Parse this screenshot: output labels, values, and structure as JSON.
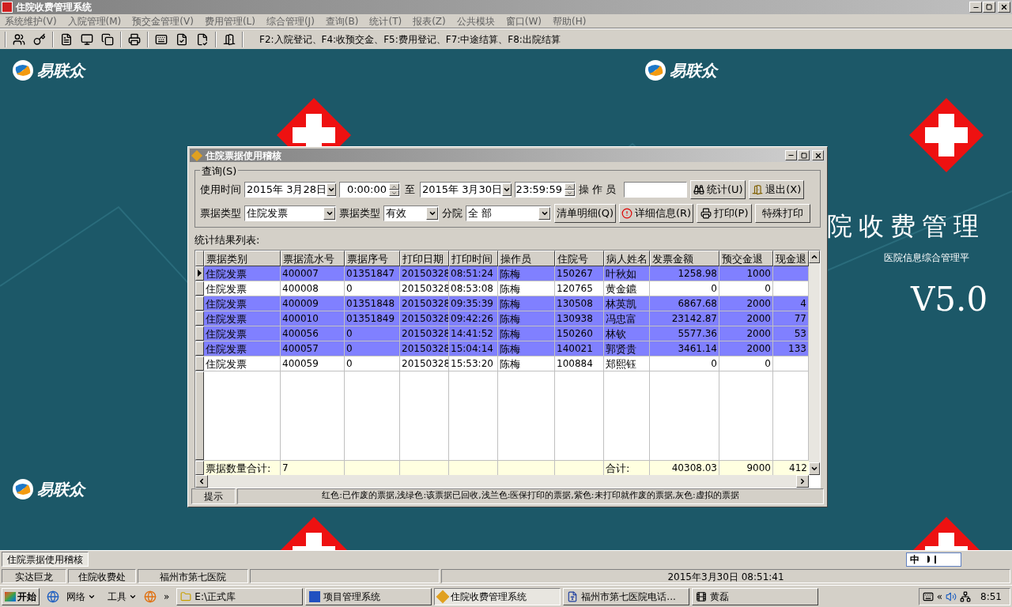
{
  "window": {
    "title": "住院收费管理系统"
  },
  "menu": [
    "系统维护(V)",
    "入院管理(M)",
    "预交金管理(V)",
    "费用管理(L)",
    "综合管理(J)",
    "查询(B)",
    "统计(T)",
    "报表(Z)",
    "公共模块",
    "窗口(W)",
    "帮助(H)"
  ],
  "toolbar": {
    "hint": "F2:入院登记、F4:收预交金、F5:费用登记、F7:中途结算、F8:出院结算"
  },
  "desktop": {
    "logos": [
      "易联众",
      "易联众",
      "易联众"
    ],
    "banner_right": "院收费管理",
    "subtitle": "医院信息综合管理平",
    "version": "V5.0"
  },
  "dialog": {
    "title": "住院票据使用稽核",
    "query": {
      "legend": "查询(S)",
      "use_time_label": "使用时间",
      "date_from": "2015年 3月28日",
      "time_from": "0:00:00",
      "to_label": "至",
      "date_to": "2015年 3月30日",
      "time_to": "23:59:59",
      "operator_label": "操 作 员",
      "bill_type_label": "票据类型",
      "bill_type": "住院发票",
      "bill_status_label": "票据类型",
      "bill_status": "有效",
      "branch_label": "分院",
      "branch": "全 部",
      "buttons": [
        {
          "label": "统计(U)",
          "kind": "stats"
        },
        {
          "label": "退出(X)",
          "kind": "exit"
        },
        {
          "label": "清单明细(Q)",
          "kind": "plain"
        },
        {
          "label": "详细信息(R)",
          "kind": "info"
        },
        {
          "label": "打印(P)",
          "kind": "print"
        },
        {
          "label": "特殊打印",
          "kind": "plain"
        }
      ]
    },
    "results_label": "统计结果列表:",
    "table": {
      "columns": [
        "票据类别",
        "票据流水号",
        "票据序号",
        "打印日期",
        "打印时间",
        "操作员",
        "住院号",
        "病人姓名",
        "发票金额",
        "预交金退",
        "现金退"
      ],
      "rows": [
        {
          "current": true,
          "color": "#8080ff",
          "type": "住院发票",
          "serial": "400007",
          "seq": "01351847",
          "date": "20150328",
          "time": "08:51:24",
          "operator": "陈梅",
          "inpatient_no": "150267",
          "patient": "叶秋如",
          "amount": "1258.98",
          "deposit": "1000"
        },
        {
          "current": false,
          "color": "#ffffff",
          "type": "住院发票",
          "serial": "400008",
          "seq": "0",
          "date": "20150328",
          "time": "08:53:08",
          "operator": "陈梅",
          "inpatient_no": "120765",
          "patient": "黄金鑣",
          "amount": "0",
          "deposit": "0"
        },
        {
          "current": false,
          "color": "#8080ff",
          "type": "住院发票",
          "serial": "400009",
          "seq": "01351848",
          "date": "20150328",
          "time": "09:35:39",
          "operator": "陈梅",
          "inpatient_no": "130508",
          "patient": "林英凯",
          "amount": "6867.68",
          "deposit": "2000",
          "cash": "4"
        },
        {
          "current": false,
          "color": "#8080ff",
          "type": "住院发票",
          "serial": "400010",
          "seq": "01351849",
          "date": "20150328",
          "time": "09:42:26",
          "operator": "陈梅",
          "inpatient_no": "130938",
          "patient": "冯忠富",
          "amount": "23142.87",
          "deposit": "2000",
          "cash": "77"
        },
        {
          "current": false,
          "color": "#8080ff",
          "type": "住院发票",
          "serial": "400056",
          "seq": "0",
          "date": "20150328",
          "time": "14:41:52",
          "operator": "陈梅",
          "inpatient_no": "150260",
          "patient": "林钦",
          "amount": "5577.36",
          "deposit": "2000",
          "cash": "53"
        },
        {
          "current": false,
          "color": "#8080ff",
          "type": "住院发票",
          "serial": "400057",
          "seq": "0",
          "date": "20150328",
          "time": "15:04:14",
          "operator": "陈梅",
          "inpatient_no": "140021",
          "patient": "郭贤贵",
          "amount": "3461.14",
          "deposit": "2000",
          "cash": "133"
        },
        {
          "current": false,
          "color": "#ffffff",
          "type": "住院发票",
          "serial": "400059",
          "seq": "0",
          "date": "20150328",
          "time": "15:53:20",
          "operator": "陈梅",
          "inpatient_no": "100884",
          "patient": "郑熙钰",
          "amount": "0",
          "deposit": "0"
        }
      ],
      "footer": {
        "label": "票据数量合计:",
        "count": "7",
        "total_label": "合计:",
        "amount_total": "40308.03",
        "deposit_total": "9000",
        "cash_total": "412"
      }
    },
    "status": {
      "hint_label": "提示",
      "legend": "红色:已作废的票据,浅绿色:该票据已回收,浅兰色:医保打印的票据,紫色:未打印就作废的票据,灰色:虚拟的票据"
    }
  },
  "mdi_tabs": [
    {
      "label": "住院票据使用稽核",
      "selected": true
    }
  ],
  "ime": {
    "label": "中"
  },
  "status_bar": [
    "实达巨龙",
    "住院收费处",
    "福州市第七医院",
    "2015年3月30日  08:51:41"
  ],
  "taskbar": {
    "start": "开始",
    "menus": [
      "网络",
      "工具"
    ],
    "chevron": "»",
    "tasks": [
      {
        "label": "E:\\正式库",
        "kind": "folder",
        "selected": false
      },
      {
        "label": "项目管理系统",
        "kind": "app",
        "selected": false
      },
      {
        "label": "住院收费管理系统",
        "kind": "hospital",
        "selected": true
      },
      {
        "label": "福州市第七医院电话...",
        "kind": "doc",
        "selected": false
      },
      {
        "label": "黄磊",
        "kind": "media",
        "selected": false
      }
    ],
    "tray_chevron": "«",
    "clock": "8:51"
  }
}
